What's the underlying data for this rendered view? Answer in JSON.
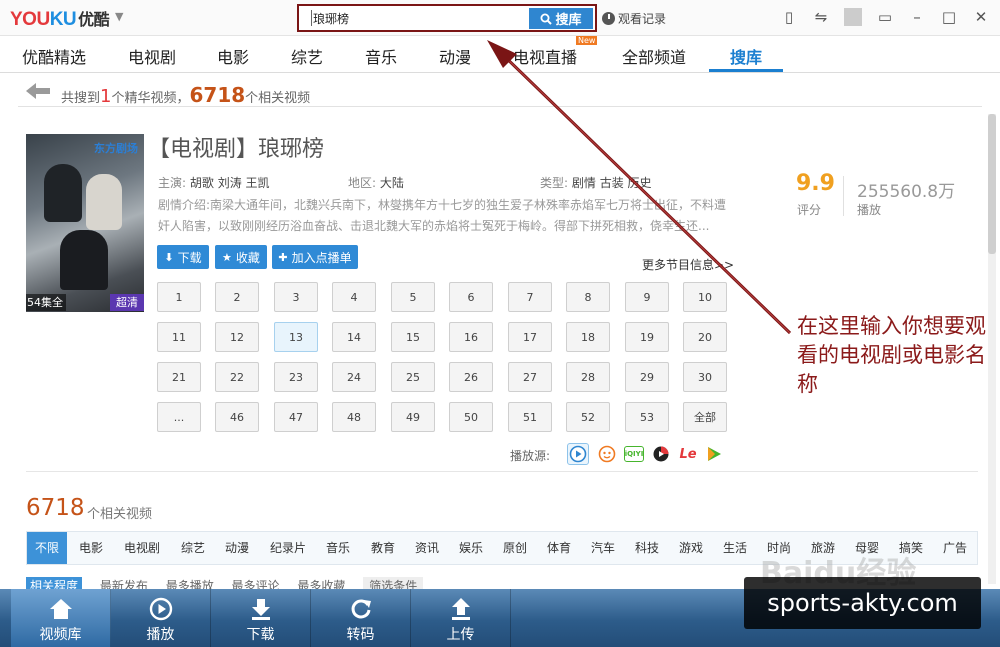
{
  "app": {
    "logo_you": "YOU",
    "logo_ku": "KU",
    "logo_cn": "优酷"
  },
  "search": {
    "value": "琅琊榜",
    "button_label": "搜库",
    "history_label": "观看记录"
  },
  "nav": {
    "items": [
      "优酷精选",
      "电视剧",
      "电影",
      "综艺",
      "音乐",
      "动漫",
      "电视直播",
      "全部频道",
      "搜库"
    ],
    "active_index": 8,
    "new_badge": "New"
  },
  "summary": {
    "prefix": "共搜到",
    "featured_count": "1",
    "featured_suffix": "个精华视频，",
    "related_count": "6718",
    "related_suffix": "个相关视频"
  },
  "show": {
    "title": "【电视剧】琅琊榜",
    "cast_label": "主演:",
    "cast": "胡歌 刘涛 王凯",
    "region_label": "地区:",
    "region": "大陆",
    "genre_label": "类型:",
    "genre": "剧情 古装 历史",
    "desc_label": "剧情介绍:",
    "desc": "南梁大通年间，北魏兴兵南下，林燮携年方十七岁的独生爱子林殊率赤焰军七万将士出征，不料遭奸人陷害，以致刚刚经历浴血奋战、击退北魏大军的赤焰将士冤死于梅岭。得部下拼死相救，侥幸生还...",
    "episodes_badge": "54集全",
    "quality_badge": "超清",
    "poster_logo": "东方剧场",
    "rating": "9.9",
    "rating_label": "评分",
    "plays": "255560.8万",
    "plays_label": "播放",
    "buttons": {
      "download": "下载",
      "favorite": "收藏",
      "playlist": "加入点播单"
    },
    "more_info": "更多节目信息>>",
    "episodes": [
      "1",
      "2",
      "3",
      "4",
      "5",
      "6",
      "7",
      "8",
      "9",
      "10",
      "11",
      "12",
      "13",
      "14",
      "15",
      "16",
      "17",
      "18",
      "19",
      "20",
      "21",
      "22",
      "23",
      "24",
      "25",
      "26",
      "27",
      "28",
      "29",
      "30",
      "...",
      "46",
      "47",
      "48",
      "49",
      "50",
      "51",
      "52",
      "53",
      "全部"
    ],
    "active_episode": "13",
    "sources_label": "播放源:",
    "sources": [
      "youku-icon",
      "tudou-icon",
      "iqiyi-icon",
      "sohu-icon",
      "letv-icon",
      "pptv-icon"
    ],
    "source_letv_text": "Le",
    "source_iqiyi_text": "iQIYI"
  },
  "related": {
    "count": "6718",
    "label": "个相关视频",
    "categories": [
      "不限",
      "电影",
      "电视剧",
      "综艺",
      "动漫",
      "纪录片",
      "音乐",
      "教育",
      "资讯",
      "娱乐",
      "原创",
      "体育",
      "汽车",
      "科技",
      "游戏",
      "生活",
      "时尚",
      "旅游",
      "母婴",
      "搞笑",
      "广告"
    ],
    "filters": [
      "相关程度",
      "最新发布",
      "最多播放",
      "最多评论",
      "最多收藏",
      "筛选条件"
    ]
  },
  "dock": {
    "items": [
      "视频库",
      "播放",
      "下载",
      "转码",
      "上传"
    ]
  },
  "annotation": {
    "text": "在这里输入你想要观看的电视剧或电影名称"
  },
  "watermark": {
    "text": "sports-akty.com",
    "bg_text": "Baidu经验"
  },
  "colors": {
    "accent_blue": "#2f86d0",
    "annotation_red": "#8b1a1a",
    "count_orange": "#c55318",
    "rating_gold": "#f0a020"
  }
}
